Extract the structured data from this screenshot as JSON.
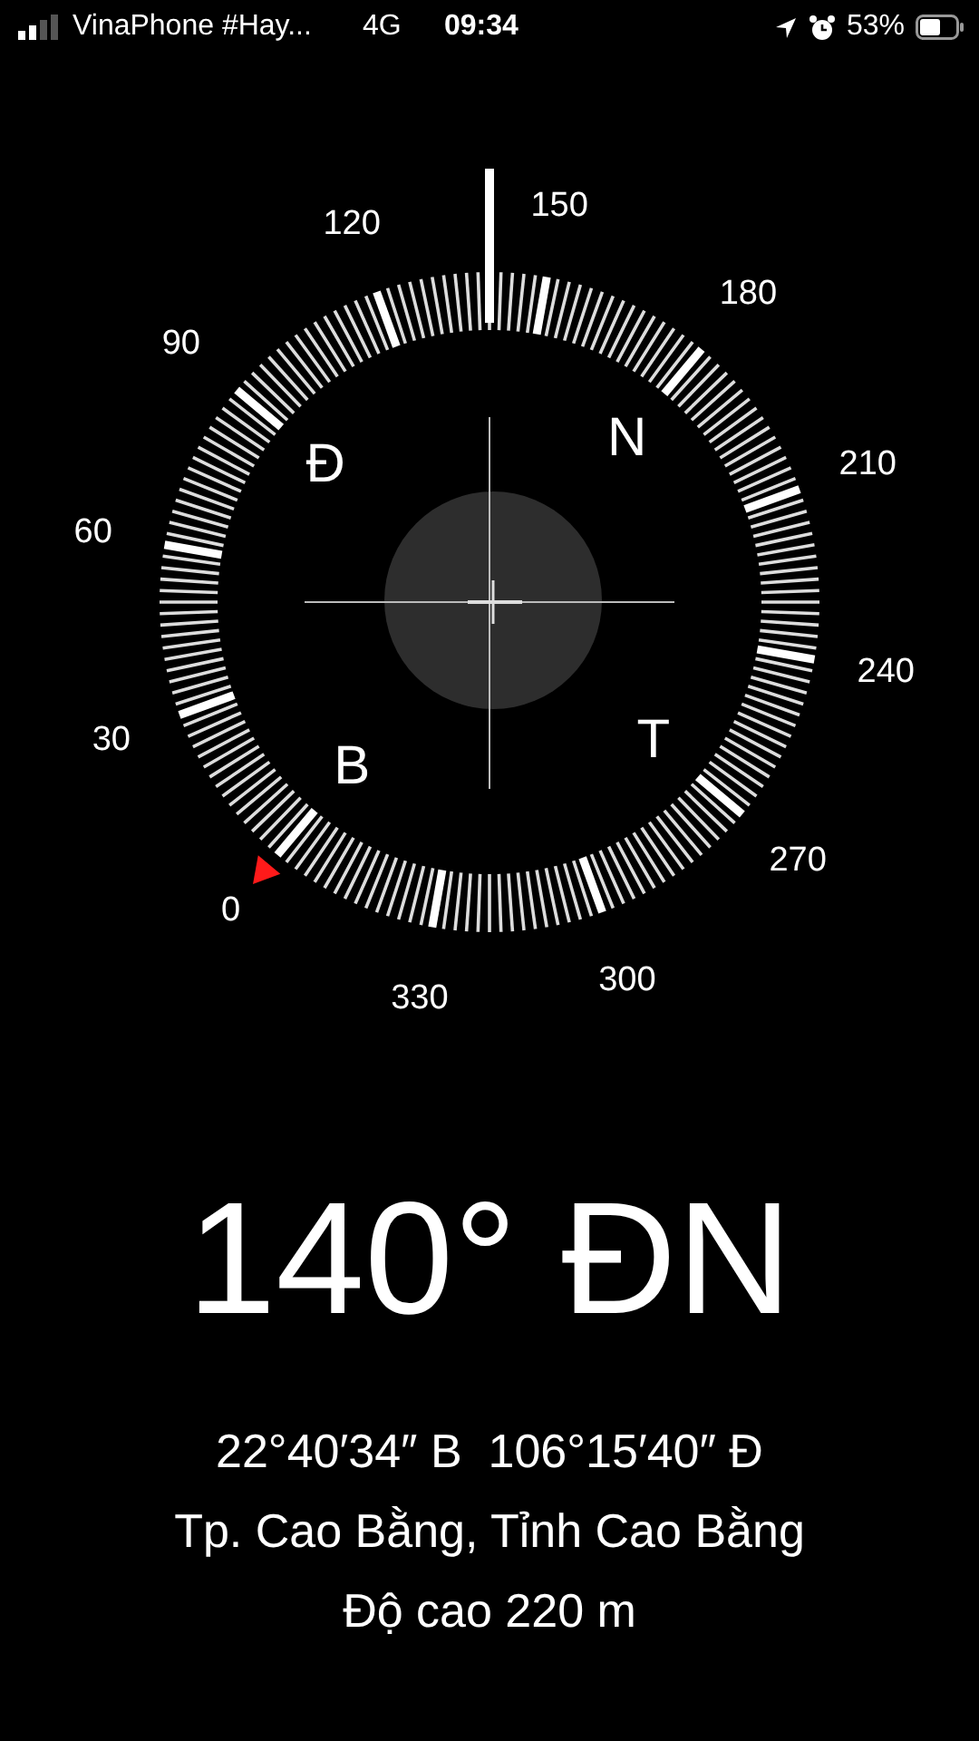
{
  "status_bar": {
    "carrier": "VinaPhone #Hay...",
    "network": "4G",
    "time": "09:34",
    "battery": "53%"
  },
  "compass": {
    "dial_labels": [
      "0",
      "30",
      "60",
      "90",
      "120",
      "150",
      "180",
      "210",
      "240",
      "270",
      "300",
      "330"
    ],
    "cardinals": [
      {
        "label": "Đ",
        "kind": "east"
      },
      {
        "label": "N",
        "kind": "south"
      },
      {
        "label": "B",
        "kind": "north"
      },
      {
        "label": "T",
        "kind": "west"
      }
    ]
  },
  "readout": {
    "heading": "140° ĐN",
    "coordinates": "22°40′34″ B  106°15′40″ Đ",
    "place": "Tp. Cao Bằng, Tỉnh Cao Bằng",
    "altitude": "Độ cao 220 m"
  }
}
